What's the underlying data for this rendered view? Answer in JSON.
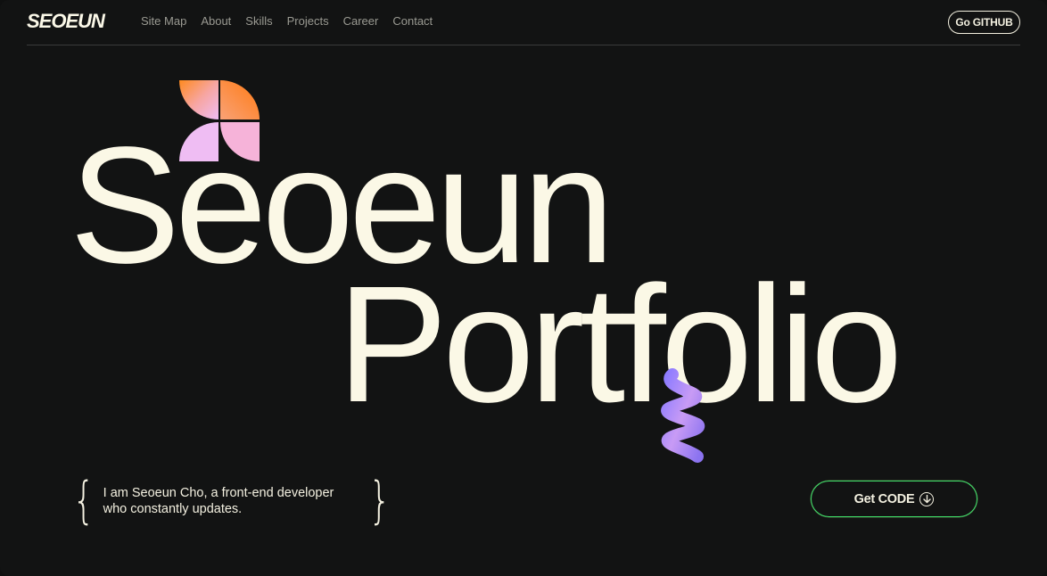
{
  "header": {
    "logo": "SEOEUN",
    "nav": [
      "Site Map",
      "About",
      "Skills",
      "Projects",
      "Career",
      "Contact"
    ],
    "github_label": "Go GITHUB"
  },
  "hero": {
    "line1": "Seoeun",
    "line2": "Portfolio"
  },
  "intro": {
    "line1": "I am Seoeun Cho, a front-end developer",
    "line2": "who constantly updates."
  },
  "cta": {
    "label": "Get CODE",
    "icon": "arrow-down-circle-icon"
  },
  "colors": {
    "background": "#121313",
    "text": "#fbf8e6",
    "accent_green": "#3fe06a",
    "orange": "#ff7a1a",
    "pink": "#f3b6f0",
    "violet": "#9b82ff"
  }
}
